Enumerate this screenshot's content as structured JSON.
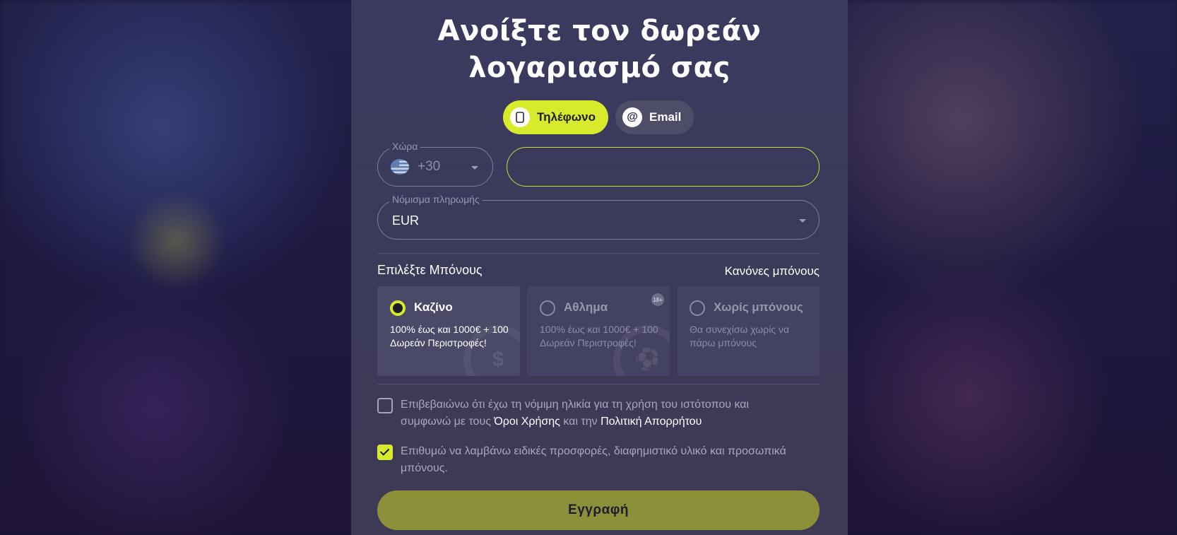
{
  "form": {
    "title": "Ανοίξτε τον δωρεάν λογαριασμό σας",
    "tabs": [
      {
        "label": "Τηλέφωνο",
        "icon": "phone-icon",
        "active": true
      },
      {
        "label": "Email",
        "icon": "at-icon",
        "active": false
      }
    ],
    "country": {
      "label": "Χώρα",
      "code": "+30",
      "flag": "greece-flag-icon"
    },
    "phone": {
      "value": ""
    },
    "currency": {
      "label": "Νόμισμα πληρωμής",
      "value": "EUR"
    },
    "bonus": {
      "title": "Επιλέξτε Μπόνους",
      "rules_link": "Κανόνες μπόνους",
      "options": [
        {
          "name": "Καζίνο",
          "desc": "100% έως και 1000€ + 100 Δωρεάν Περιστροφές!",
          "selected": true
        },
        {
          "name": "Αθλημα",
          "desc": "100% έως και 1000€ + 100 Δωρεάν Περιστροφές!",
          "selected": false,
          "badge": "18+"
        },
        {
          "name": "Χωρίς μπόνους",
          "desc": "Θα συνεχίσω χωρίς να πάρω μπόνους",
          "selected": false
        }
      ]
    },
    "consent_age": {
      "checked": false,
      "text_before": "Επιβεβαιώνω ότι έχω τη νόμιμη ηλικία για τη χρήση του ιστότοπου και συμφωνώ με τους ",
      "terms_link": "Όροι Χρήσης",
      "text_middle": " και την ",
      "privacy_link": "Πολιτική Απορρήτου"
    },
    "consent_marketing": {
      "checked": true,
      "text": "Επιθυμώ να λαμβάνω ειδικές προσφορές, διαφημιστικό υλικό και προσωπικά μπόνους."
    },
    "submit_label": "Εγγραφή"
  },
  "colors": {
    "accent": "#d8ea2c",
    "panel": "#3a3a5f",
    "submit": "#8c9038"
  }
}
